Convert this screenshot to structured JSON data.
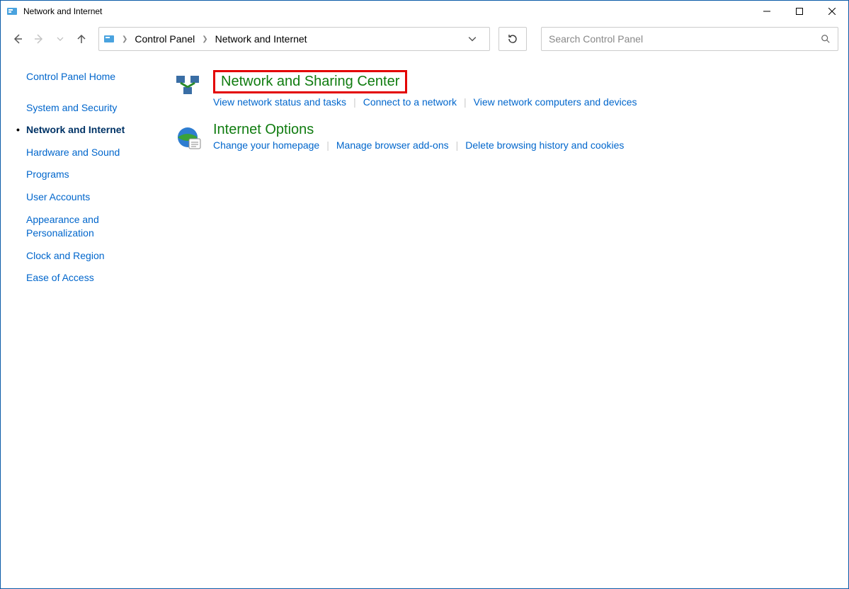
{
  "titlebar": {
    "title": "Network and Internet"
  },
  "breadcrumb": {
    "root": "Control Panel",
    "current": "Network and Internet"
  },
  "search": {
    "placeholder": "Search Control Panel"
  },
  "sidebar": {
    "home": "Control Panel Home",
    "items": [
      {
        "label": "System and Security",
        "active": false
      },
      {
        "label": "Network and Internet",
        "active": true
      },
      {
        "label": "Hardware and Sound",
        "active": false
      },
      {
        "label": "Programs",
        "active": false
      },
      {
        "label": "User Accounts",
        "active": false
      },
      {
        "label": "Appearance and Personalization",
        "active": false
      },
      {
        "label": "Clock and Region",
        "active": false
      },
      {
        "label": "Ease of Access",
        "active": false
      }
    ]
  },
  "categories": [
    {
      "title": "Network and Sharing Center",
      "highlighted": true,
      "links": [
        "View network status and tasks",
        "Connect to a network",
        "View network computers and devices"
      ]
    },
    {
      "title": "Internet Options",
      "highlighted": false,
      "links": [
        "Change your homepage",
        "Manage browser add-ons",
        "Delete browsing history and cookies"
      ]
    }
  ]
}
